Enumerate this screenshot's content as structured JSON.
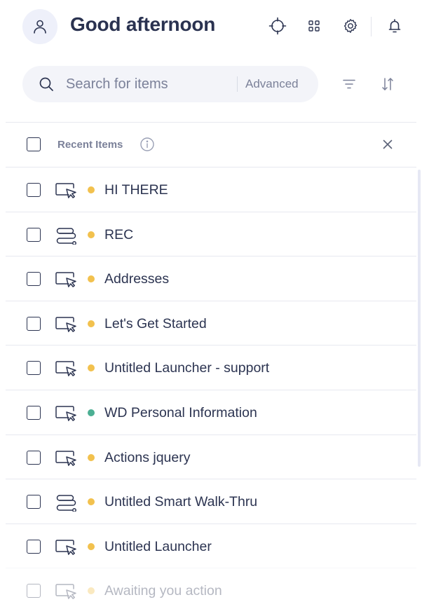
{
  "header": {
    "greeting": "Good afternoon",
    "icons": [
      "user-icon",
      "target-icon",
      "grid-icon",
      "settings-icon",
      "bell-icon"
    ]
  },
  "search": {
    "placeholder": "Search for items",
    "value": "",
    "advanced_label": "Advanced"
  },
  "section": {
    "label": "Recent Items"
  },
  "colors": {
    "draft": "#f2c14e",
    "published": "#4caf93",
    "text": "#2c3451",
    "muted": "#7b8199"
  },
  "items": [
    {
      "title": "HI THERE",
      "type": "launcher-icon",
      "status": "draft"
    },
    {
      "title": "REC",
      "type": "smart-walkthru-icon",
      "status": "draft"
    },
    {
      "title": "Addresses",
      "type": "launcher-icon",
      "status": "draft"
    },
    {
      "title": "Let's Get Started",
      "type": "launcher-icon",
      "status": "draft"
    },
    {
      "title": "Untitled Launcher - support",
      "type": "launcher-icon",
      "status": "draft"
    },
    {
      "title": "WD Personal Information",
      "type": "launcher-icon",
      "status": "published"
    },
    {
      "title": "Actions jquery",
      "type": "launcher-icon",
      "status": "draft"
    },
    {
      "title": "Untitled Smart Walk-Thru",
      "type": "smart-walkthru-icon",
      "status": "draft"
    },
    {
      "title": "Untitled Launcher",
      "type": "launcher-icon",
      "status": "draft"
    },
    {
      "title": "Awaiting you action",
      "type": "launcher-icon",
      "status": "draft"
    }
  ]
}
